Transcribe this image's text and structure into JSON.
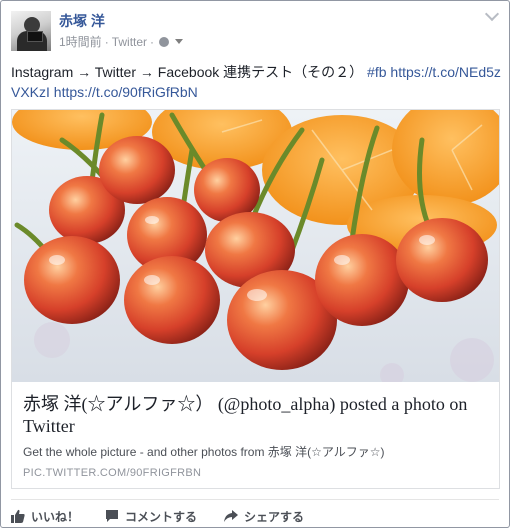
{
  "author": {
    "name": "赤塚 洋",
    "timestamp": "1時間前",
    "source": "Twitter",
    "separator": "·"
  },
  "post": {
    "text": "Instagram → Twitter → Facebook 連携テスト（その２）",
    "hashtag": "#fb",
    "link1": "https://t.co/NEd5zVXKzI",
    "link2": "https://t.co/90fRiGfRbN"
  },
  "attachment": {
    "title": "赤塚 洋(☆アルファ☆）  (@photo_alpha) posted a photo on Twitter",
    "description": "Get the whole picture - and other photos from 赤塚 洋(☆アルファ☆)",
    "domain": "PIC.TWITTER.COM/90FRIGFRBN"
  },
  "actions": {
    "like": "いいね！",
    "comment": "コメントする",
    "share": "シェアする"
  },
  "colors": {
    "link": "#365899",
    "muted": "#90949c",
    "text": "#1d2129"
  },
  "icons": [
    "globe-icon",
    "caret-down-icon",
    "chevron-down-icon",
    "like-icon",
    "comment-icon",
    "share-icon"
  ]
}
